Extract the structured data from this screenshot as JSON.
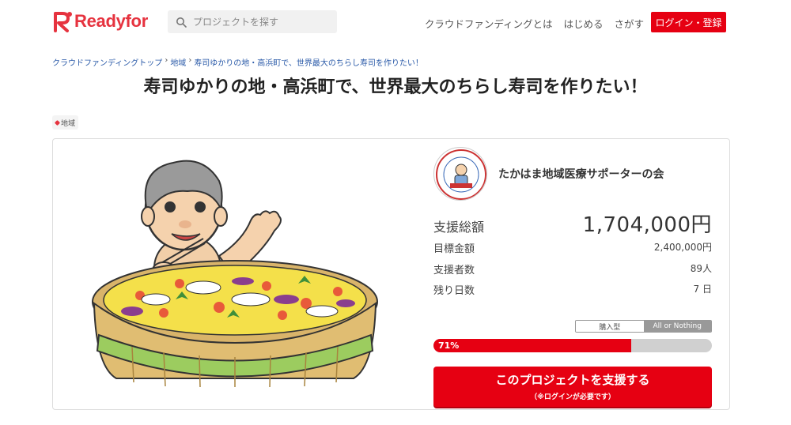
{
  "header": {
    "logo_text": "Readyfor",
    "search_placeholder": "プロジェクトを探す",
    "nav": [
      "クラウドファンディングとは",
      "はじめる",
      "さがす"
    ],
    "login_label": "ログイン・登録"
  },
  "breadcrumb": [
    "クラウドファンディングトップ",
    "地域",
    "寿司ゆかりの地・高浜町で、世界最大のちらし寿司を作りたい！"
  ],
  "project": {
    "title": "寿司ゆかりの地・高浜町で、世界最大のちらし寿司を作りたい！",
    "tag": "地域",
    "owner_name": "たかはま地域医療サポーターの会",
    "total_label": "支援総額",
    "total_value": "1,704,000円",
    "goal_label": "目標金額",
    "goal_value": "2,400,000円",
    "supporters_label": "支援者数",
    "supporters_value": "89人",
    "days_label": "残り日数",
    "days_value": "7 日",
    "type_options": [
      "購入型",
      "All or Nothing"
    ],
    "type_selected": "All or Nothing",
    "progress_label": "71%",
    "progress_percent": 71,
    "support_button": "このプロジェクトを支援する",
    "support_button_sub": "（※ログインが必要です）"
  },
  "colors": {
    "brand": "#e6333f",
    "accent": "#e60012",
    "link": "#2a5aa8"
  }
}
